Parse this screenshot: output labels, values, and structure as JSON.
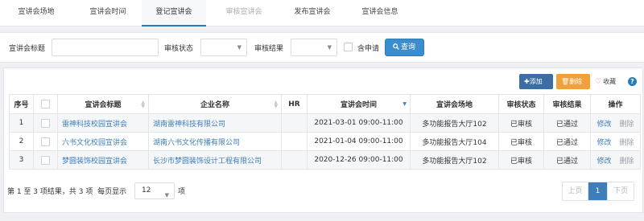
{
  "tabs": [
    {
      "label": "宣讲会场地"
    },
    {
      "label": "宣讲会时间"
    },
    {
      "label": "登记宣讲会"
    },
    {
      "label": "审核宣讲会"
    },
    {
      "label": "发布宣讲会"
    },
    {
      "label": "宣讲会信息"
    }
  ],
  "filter": {
    "title_label": "宣讲会标题",
    "title_value": "",
    "status_label": "审核状态",
    "status_value": "",
    "result_label": "审核结果",
    "result_value": "",
    "include_apply_label": "含申请",
    "search_label": "查询"
  },
  "toolbar": {
    "add_label": "添加",
    "delete_label": "删除",
    "favorite_label": "收藏",
    "help_label": "?"
  },
  "table": {
    "headers": [
      "序号",
      "",
      "宣讲会标题",
      "企业名称",
      "HR",
      "宣讲会时间",
      "宣讲会场地",
      "审核状态",
      "审核结果",
      "操作"
    ],
    "rows": [
      {
        "no": "1",
        "title": "雷神科技校园宣讲会",
        "company": "湖南雷神科技有限公司",
        "hr": "",
        "time": "2021-03-01 09:00-11:00",
        "venue": "多功能报告大厅102",
        "status": "已审核",
        "result": "已通过",
        "edit": "修改",
        "del": "删除"
      },
      {
        "no": "2",
        "title": "六书文化校园宣讲会",
        "company": "湖南六书文化传播有限公司",
        "hr": "",
        "time": "2021-01-04 09:00-11:00",
        "venue": "多功能报告大厅104",
        "status": "已审核",
        "result": "已通过",
        "edit": "修改",
        "del": "删除"
      },
      {
        "no": "3",
        "title": "梦圆装饰校园宣讲会",
        "company": "长沙市梦圆装饰设计工程有限公司",
        "hr": "",
        "time": "2020-12-26 09:00-11:00",
        "venue": "多功能报告大厅102",
        "status": "已审核",
        "result": "已通过",
        "edit": "修改",
        "del": "删除"
      }
    ]
  },
  "footer": {
    "summary": "第 1 至 3 项结果，共 3 项",
    "per_page_label": "每页显示",
    "page_size": "12",
    "unit": "项",
    "prev_label": "上页",
    "current_page": "1",
    "next_label": "下页"
  },
  "colors": {
    "primary": "#3c8dcb",
    "add_button": "#3a6ea5",
    "delete_button": "#f0a13a",
    "link": "#3c7eb8"
  }
}
